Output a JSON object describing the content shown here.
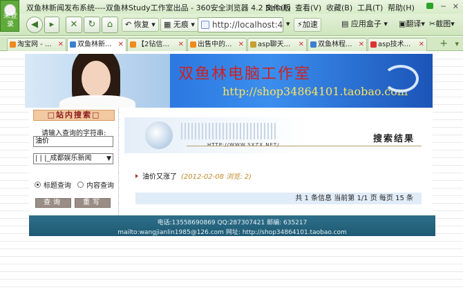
{
  "browser": {
    "login_label": "未登录",
    "window_title": "双鱼林新闻发布系统----双鱼林Study工作室出品 - 360安全浏览器 4.2 Beta版",
    "menu": [
      "文件(F)",
      "查看(V)",
      "收藏(B)",
      "工具(T)",
      "帮助(H)"
    ],
    "toolbar": {
      "restore": "恢复",
      "no_trace": "无痕",
      "address": "http://localhost:45",
      "accelerate": "加速",
      "app_box": "应用盒子",
      "translate": "翻译",
      "screenshot": "截图"
    },
    "tabs": [
      {
        "label": "淘宝网 - ...",
        "active": false
      },
      {
        "label": "双鱼林新...",
        "active": true
      },
      {
        "label": "【2钻信...",
        "active": false
      },
      {
        "label": "出售中的...",
        "active": false
      },
      {
        "label": "asp聊天...",
        "active": false
      },
      {
        "label": "双鱼林程...",
        "active": false
      },
      {
        "label": "asp技术...",
        "active": false
      }
    ]
  },
  "banner": {
    "headline": "双鱼林电脑工作室",
    "url": "http://shop34864101.taobao.com"
  },
  "sidebar": {
    "title": "□站内搜索□",
    "prompt": "请输入查询的字符串:",
    "keyword_value": "油价",
    "category_value": "| | |_成都娱乐新闻",
    "radio_title": "标题查询",
    "radio_content": "内容查询",
    "search_button": "查询",
    "reset_button": "重写"
  },
  "results": {
    "header_url": "HTTP://WWW.SXZX.NET/",
    "title": "搜索结果",
    "items": [
      {
        "title": "油价又涨了",
        "meta": "(2012-02-08 浏览: 2)"
      }
    ],
    "pager": "共 1 条信息 当前第 1/1 页 每页 15 条"
  },
  "footer": {
    "line1": "电话:13558690869     QQ:287307421    邮编: 635217",
    "line2": "mailto:wangjianlin1985@126.com 网址:  http://shop34864101.taobao.com"
  }
}
